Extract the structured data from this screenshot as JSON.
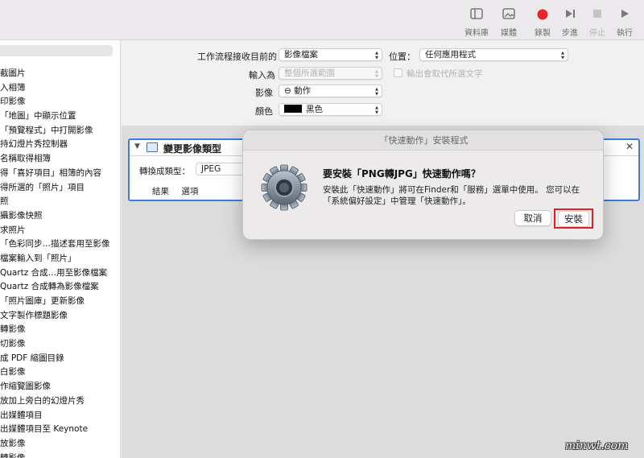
{
  "toolbar": {
    "library": {
      "label": "資料庫",
      "icon": "sidebar-icon"
    },
    "media": {
      "label": "媒體",
      "icon": "photo-icon"
    },
    "record": {
      "label": "錄製",
      "icon": "record-icon",
      "color": "#e8242a"
    },
    "step": {
      "label": "步進",
      "icon": "step-icon"
    },
    "stop": {
      "label": "停止",
      "icon": "stop-icon"
    },
    "run": {
      "label": "執行",
      "icon": "play-icon"
    }
  },
  "sidebar": {
    "items": [
      "截圖片",
      "入相簿",
      "印影像",
      "「地圖」中顯示位置",
      "「預覽程式」中打開影像",
      "持幻燈片秀控制器",
      "名稱取得相簿",
      "得「喜好項目」相簿的內容",
      "得所選的「照片」項目",
      "照",
      "攝影像快照",
      "求照片",
      "「色彩同步…描述套用至影像",
      "檔案輸入到「照片」",
      "Quartz 合成…用至影像檔案",
      "Quartz 合成轉為影像檔案",
      "「照片圖庫」更新影像",
      "文字製作標題影像",
      "轉影像",
      "切影像",
      "成 PDF 縮圖目錄",
      "白影像",
      "作縮覽圖影像",
      "放加上旁白的幻燈片秀",
      "出媒體項目",
      "出媒體項目至 Keynote",
      "放影像",
      "轉影像"
    ]
  },
  "workflow": {
    "receives_label": "工作流程接收目前的",
    "receives_value": "影像檔案",
    "location_label": "位置：",
    "location_value": "任何應用程式",
    "input_label": "輸入為",
    "input_value": "整個所選範圍",
    "replace_label": "輸出會取代所選文字",
    "image_label": "影像",
    "image_value": "⊖ 動作",
    "color_label": "顏色",
    "color_value": "黑色",
    "color_swatch": "#000000"
  },
  "action": {
    "title": "變更影像類型",
    "convert_label": "轉換成類型：",
    "convert_value": "JPEG",
    "tab_results": "結果",
    "tab_options": "選項",
    "close": "✕",
    "disclose": "▼",
    "accent": "#3b7de0"
  },
  "dialog": {
    "title": "「快速動作」安裝程式",
    "heading": "要安裝「PNG轉JPG」快速動作嗎？",
    "message": "安裝此「快速動作」將可在Finder和「服務」選單中使用。 您可以在「系統偏好設定」中管理「快速動作」。",
    "cancel": "取消",
    "install": "安裝",
    "highlight": "#e02020"
  },
  "watermark": "minwt.com"
}
